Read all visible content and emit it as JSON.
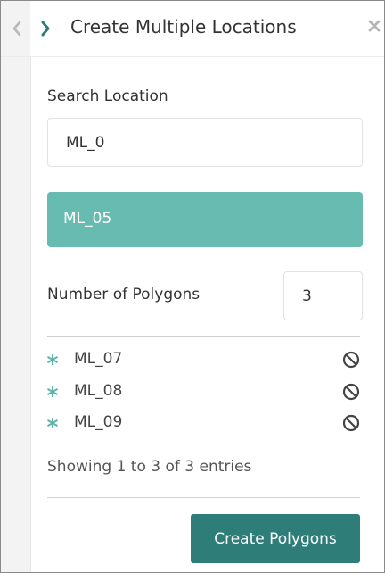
{
  "header": {
    "title": "Create Multiple Locations",
    "back_icon": "chevron-left-icon",
    "forward_icon": "chevron-right-icon",
    "close_icon": "close-icon",
    "accent_color": "#2f7d79"
  },
  "search": {
    "label": "Search Location",
    "value": "ML_0",
    "suggestion": "ML_05",
    "suggestion_color": "#67bbb0"
  },
  "polygons": {
    "label": "Number of Polygons",
    "value": "3"
  },
  "list": {
    "items": [
      {
        "name": "ML_07",
        "icon": "asterisk-icon",
        "action_icon": "block-icon"
      },
      {
        "name": "ML_08",
        "icon": "asterisk-icon",
        "action_icon": "block-icon"
      },
      {
        "name": "ML_09",
        "icon": "asterisk-icon",
        "action_icon": "block-icon"
      }
    ],
    "status": "Showing 1 to 3 of 3 entries"
  },
  "actions": {
    "create_label": "Create Polygons",
    "create_color": "#2f7d79"
  }
}
